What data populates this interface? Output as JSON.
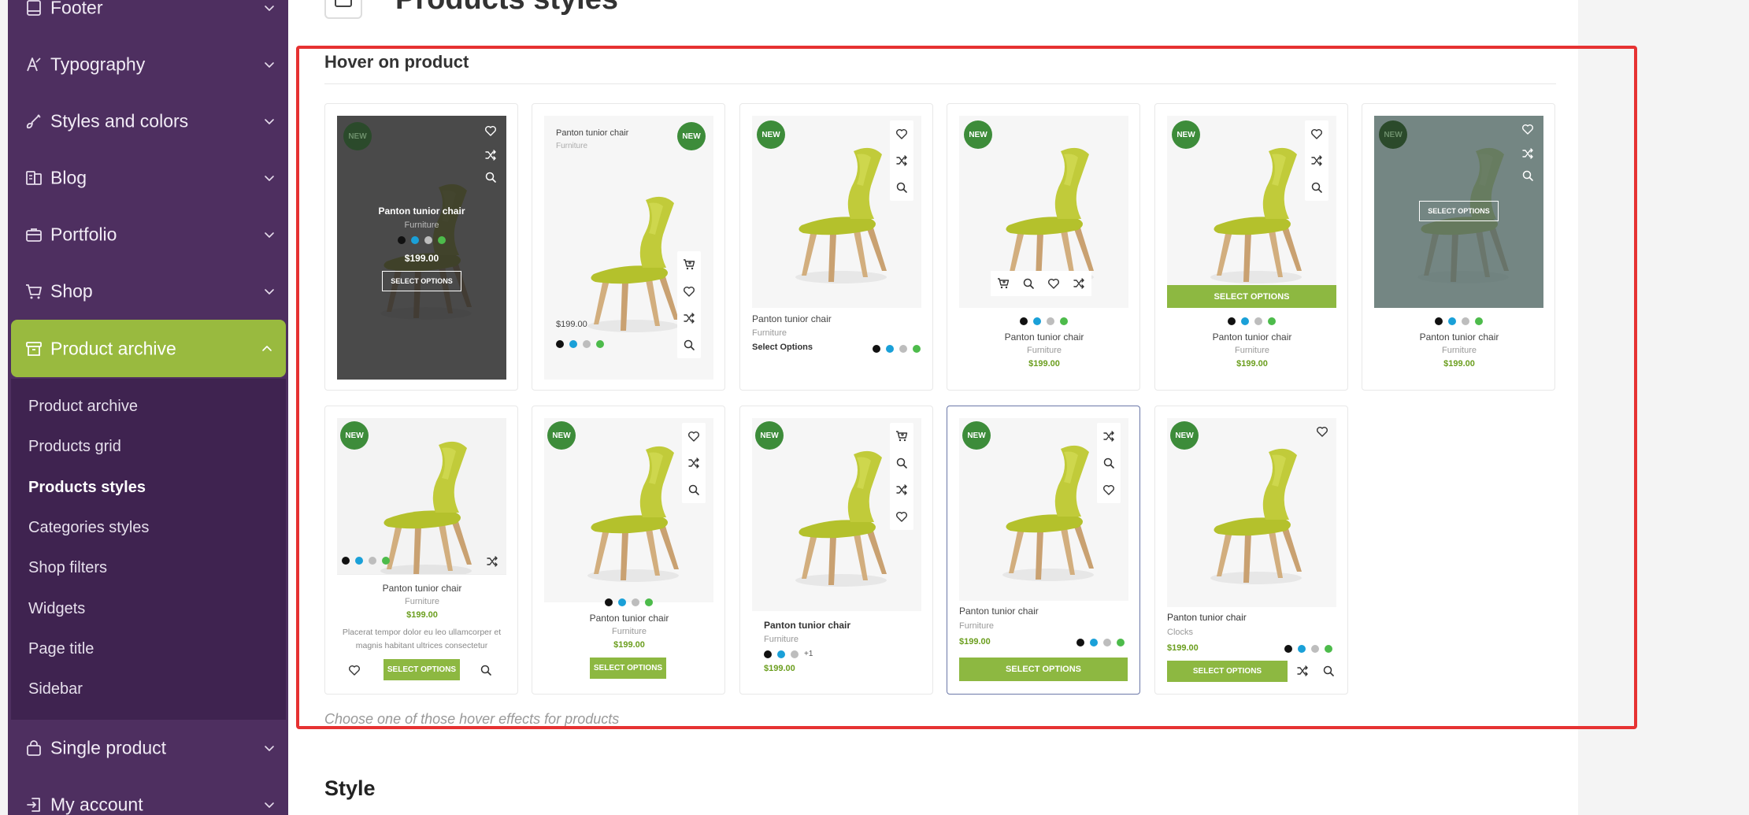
{
  "sidebar": {
    "items": [
      {
        "label": "Footer",
        "icon": "footer-icon"
      },
      {
        "label": "Typography",
        "icon": "typography-icon"
      },
      {
        "label": "Styles and colors",
        "icon": "brush-icon"
      },
      {
        "label": "Blog",
        "icon": "blog-icon"
      },
      {
        "label": "Portfolio",
        "icon": "briefcase-icon"
      },
      {
        "label": "Shop",
        "icon": "cart-icon"
      },
      {
        "label": "Product archive",
        "icon": "archive-icon"
      },
      {
        "label": "Single product",
        "icon": "bag-icon"
      },
      {
        "label": "My account",
        "icon": "login-icon"
      }
    ],
    "submenu": [
      "Product archive",
      "Products grid",
      "Products styles",
      "Categories styles",
      "Shop filters",
      "Widgets",
      "Page title",
      "Sidebar"
    ]
  },
  "page": {
    "title": "Products styles",
    "section_heading": "Hover on product",
    "section_description": "Choose one of those hover effects for products",
    "next_heading": "Style"
  },
  "product": {
    "name": "Panton tunior chair",
    "category": "Furniture",
    "alt_category": "Clocks",
    "price": "$199.00",
    "badge": "NEW",
    "select_upper": "SELECT OPTIONS",
    "select_title": "Select Options",
    "description": "Placerat tempor dolor eu leo ullamcorper et magnis habitant ultrices consectetur",
    "more_colors": "+1"
  },
  "colors": {
    "accent": "#99ba3f",
    "sidebar_bg": "#4e2f60",
    "submenu_bg": "#3f2350",
    "badge_green": "#3d8c3a",
    "button_green": "#8db841",
    "price_green": "#6b9e1e",
    "highlight_red": "#e63232",
    "swatches": [
      "#111111",
      "#1aa0d8",
      "#bdbdbd",
      "#4dbb4b"
    ]
  }
}
